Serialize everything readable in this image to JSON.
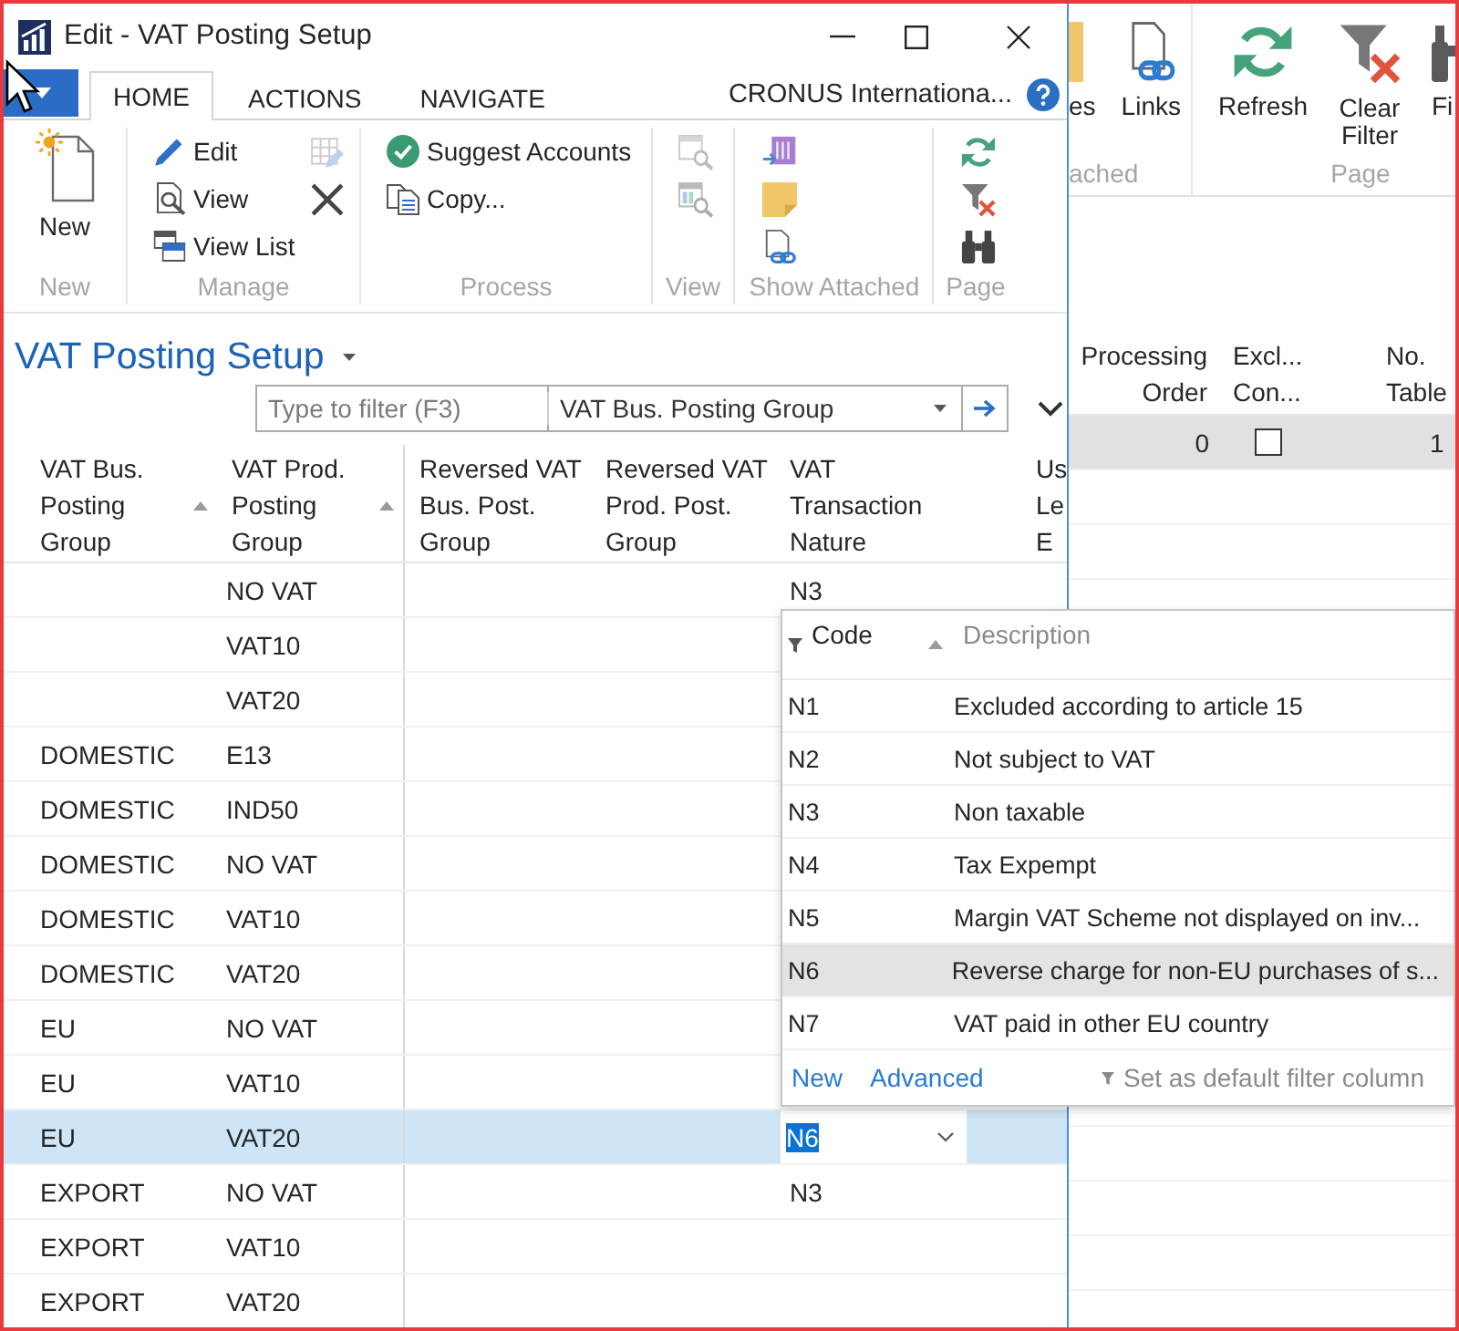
{
  "window": {
    "title": "Edit - VAT Posting Setup"
  },
  "ribbon_tabs": [
    {
      "label": "HOME",
      "selected": true
    },
    {
      "label": "ACTIONS",
      "selected": false
    },
    {
      "label": "NAVIGATE",
      "selected": false
    }
  ],
  "company": "CRONUS Internationa...",
  "ribbon_groups": [
    {
      "label": "New",
      "items": [
        {
          "kind": "large",
          "label": "New"
        }
      ]
    },
    {
      "label": "Manage",
      "items": [
        {
          "kind": "small",
          "label": "Edit"
        },
        {
          "kind": "small",
          "label": "View"
        },
        {
          "kind": "small",
          "label": "View List"
        },
        {
          "kind": "icon",
          "disabled": true
        },
        {
          "kind": "icon",
          "disabled": false
        }
      ]
    },
    {
      "label": "Process",
      "items": [
        {
          "kind": "small",
          "label": "Suggest Accounts"
        },
        {
          "kind": "small",
          "label": "Copy..."
        }
      ]
    },
    {
      "label": "View",
      "items": [
        {
          "kind": "icon",
          "disabled": true
        },
        {
          "kind": "icon",
          "disabled": true
        }
      ]
    },
    {
      "label": "Show Attached",
      "items": [
        {
          "kind": "icon",
          "disabled": false
        },
        {
          "kind": "icon",
          "disabled": false
        },
        {
          "kind": "icon",
          "disabled": false
        }
      ]
    },
    {
      "label": "Page",
      "items": [
        {
          "kind": "icon",
          "disabled": false
        },
        {
          "kind": "icon",
          "disabled": false
        },
        {
          "kind": "icon",
          "disabled": false
        }
      ]
    }
  ],
  "page_title": "VAT Posting Setup",
  "filter": {
    "placeholder": "Type to filter (F3)",
    "field": "VAT Bus. Posting Group"
  },
  "table": {
    "columns": [
      {
        "lines": [
          "VAT Bus.",
          "Posting",
          "Group"
        ],
        "sorted": true
      },
      {
        "lines": [
          "VAT Prod.",
          "Posting",
          "Group"
        ],
        "sorted": true
      },
      {
        "lines": [
          "Reversed VAT",
          "Bus. Post.",
          "Group"
        ],
        "sorted": false
      },
      {
        "lines": [
          "Reversed VAT",
          "Prod. Post.",
          "Group"
        ],
        "sorted": false
      },
      {
        "lines": [
          "VAT",
          "Transaction",
          "Nature"
        ],
        "sorted": false
      },
      {
        "lines": [
          "Us",
          "Le",
          "E"
        ]
      }
    ],
    "rows": [
      {
        "prod_group": "NO VAT",
        "nature": "N3",
        "selected": false
      },
      {
        "prod_group": "VAT10",
        "selected": false
      },
      {
        "prod_group": "VAT20",
        "selected": false
      },
      {
        "bus_group": "DOMESTIC",
        "prod_group": "E13",
        "selected": false
      },
      {
        "bus_group": "DOMESTIC",
        "prod_group": "IND50",
        "selected": false
      },
      {
        "bus_group": "DOMESTIC",
        "prod_group": "NO VAT",
        "selected": false
      },
      {
        "bus_group": "DOMESTIC",
        "prod_group": "VAT10",
        "selected": false
      },
      {
        "bus_group": "DOMESTIC",
        "prod_group": "VAT20",
        "selected": false
      },
      {
        "bus_group": "EU",
        "prod_group": "NO VAT",
        "selected": false
      },
      {
        "bus_group": "EU",
        "prod_group": "VAT10",
        "selected": false
      },
      {
        "bus_group": "EU",
        "prod_group": "VAT20",
        "nature": "N6",
        "selected": true
      },
      {
        "bus_group": "EXPORT",
        "prod_group": "NO VAT",
        "nature": "N3",
        "selected": false
      },
      {
        "bus_group": "EXPORT",
        "prod_group": "VAT10",
        "selected": false
      },
      {
        "bus_group": "EXPORT",
        "prod_group": "VAT20",
        "selected": false
      }
    ]
  },
  "lookup": {
    "columns": [
      {
        "label": "Code",
        "filter_column": true,
        "sorted": true
      },
      {
        "label": "Description",
        "filter_column": false,
        "sorted": false
      }
    ],
    "rows": [
      {
        "code": "N1",
        "description": "Excluded according to article 15",
        "selected": false
      },
      {
        "code": "N2",
        "description": "Not subject to VAT",
        "selected": false
      },
      {
        "code": "N3",
        "description": "Non taxable",
        "selected": false
      },
      {
        "code": "N4",
        "description": "Tax Expempt",
        "selected": false
      },
      {
        "code": "N5",
        "description": "Margin VAT Scheme not displayed on inv...",
        "selected": false
      },
      {
        "code": "N6",
        "description": "Reverse charge for non-EU purchases of s...",
        "selected": true
      },
      {
        "code": "N7",
        "description": "VAT paid in other EU country",
        "selected": false
      }
    ],
    "actions": [
      "New",
      "Advanced"
    ],
    "default_filter": "Set as default filter column"
  },
  "back_window": {
    "ribbon_groups": [
      {
        "label": "ached",
        "items": [
          {
            "label": "es"
          },
          {
            "label": "Links"
          }
        ]
      },
      {
        "label": "Page",
        "items": [
          {
            "label": "Refresh"
          },
          {
            "label": "Clear Filter"
          },
          {
            "label": "Fi"
          }
        ]
      }
    ],
    "columns": [
      {
        "lines": [
          "Processing",
          "Order"
        ]
      },
      {
        "lines": [
          "Excl...",
          "Con..."
        ]
      },
      {
        "lines": [
          "No.",
          "Table"
        ]
      }
    ],
    "rows": [
      {
        "processing_order": "0",
        "checked": false,
        "column_3": "1",
        "selected": true
      }
    ]
  }
}
